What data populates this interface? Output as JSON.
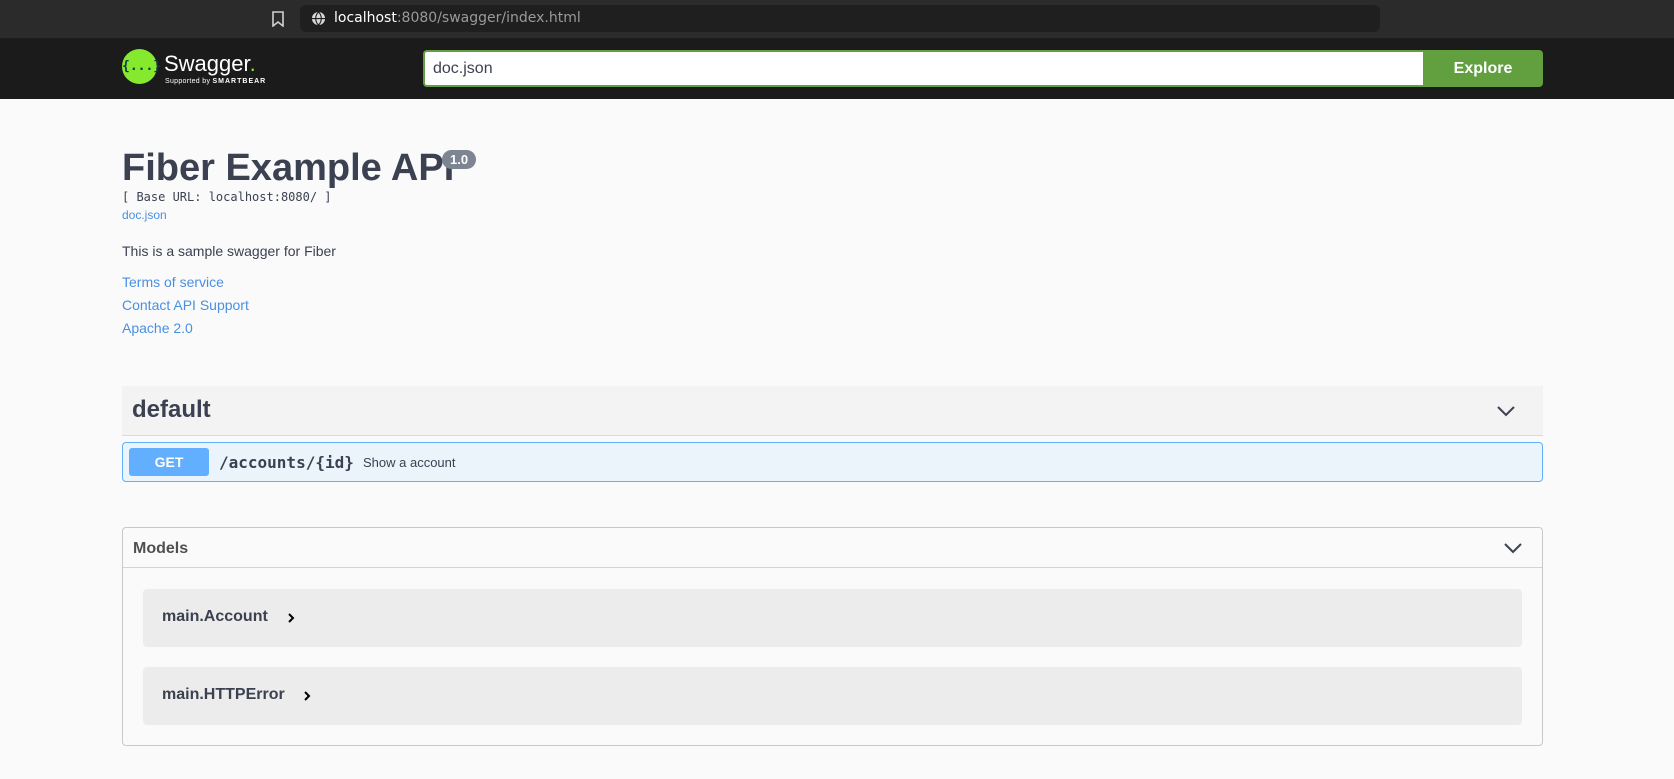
{
  "browser": {
    "url_host": "localhost",
    "url_rest": ":8080/swagger/index.html"
  },
  "topbar": {
    "logo_word": "Swagger",
    "logo_dot": ".",
    "logo_sub_prefix": "Supported by ",
    "logo_sub_brand": "SMARTBEAR",
    "logo_glyph": "{...}",
    "explore_value": "doc.json",
    "explore_label": "Explore"
  },
  "info": {
    "title": "Fiber Example API",
    "version": "1.0",
    "base_url": "[ Base URL: localhost:8080/ ]",
    "doc_link": "doc.json",
    "description": "This is a sample swagger for Fiber",
    "links": [
      "Terms of service",
      "Contact API Support",
      "Apache 2.0"
    ]
  },
  "tag": {
    "name": "default",
    "operations": [
      {
        "method": "GET",
        "path": "/accounts/{id}",
        "summary": "Show a account"
      }
    ]
  },
  "models": {
    "title": "Models",
    "items": [
      "main.Account",
      "main.HTTPError"
    ]
  },
  "colors": {
    "topbar_bg": "#1b1b1b",
    "explore_green": "#62a03f",
    "get_blue": "#61affe",
    "link_blue": "#4990e2"
  }
}
